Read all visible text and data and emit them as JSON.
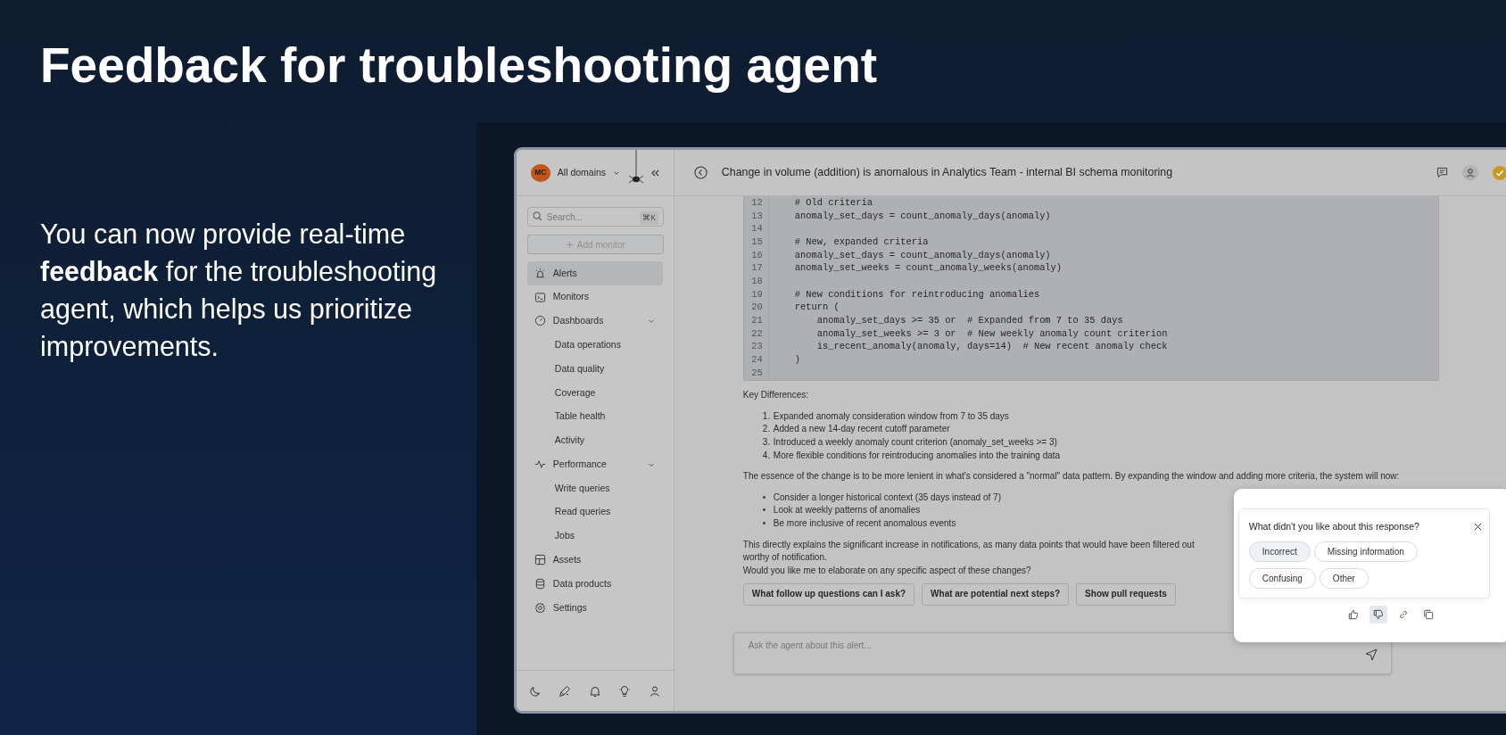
{
  "headline": "Feedback for troubleshooting agent",
  "blurb": "You can now provide real-time **feedback** for the troubleshooting agent, which helps us prioritize improvements.",
  "app": {
    "sidebar": {
      "avatar": "MC",
      "domain": "All domains",
      "search": {
        "placeholder": "Search...",
        "shortcut": "⌘K"
      },
      "add_button": {
        "label": "Add monitor",
        "disabled": true
      },
      "items": [
        {
          "label": "Alerts",
          "selected": true
        },
        {
          "label": "Monitors",
          "selected": false
        },
        {
          "label": "Dashboards",
          "selected": false,
          "expanded": true,
          "children": [
            {
              "label": "Data operations",
              "selected": false
            },
            {
              "label": "Data quality",
              "selected": false
            },
            {
              "label": "Coverage",
              "selected": false
            },
            {
              "label": "Table health",
              "selected": false
            },
            {
              "label": "Activity",
              "selected": false
            }
          ]
        },
        {
          "label": "Performance",
          "selected": false,
          "expanded": true,
          "children": [
            {
              "label": "Write queries",
              "selected": false
            },
            {
              "label": "Read queries",
              "selected": false
            },
            {
              "label": "Jobs",
              "selected": false
            }
          ]
        },
        {
          "label": "Assets",
          "selected": false
        },
        {
          "label": "Data products",
          "selected": false
        },
        {
          "label": "Settings",
          "selected": false
        }
      ]
    },
    "header": {
      "title": "Change in volume (addition) is anomalous in Analytics Team - internal BI schema monitoring"
    },
    "code": [
      {
        "n": "12",
        "text": "    # Old criteria"
      },
      {
        "n": "13",
        "text": "    anomaly_set_days = count_anomaly_days(anomaly)"
      },
      {
        "n": "14"
      },
      {
        "n": "15",
        "text": "    # New, expanded criteria"
      },
      {
        "n": "16",
        "text": "    anomaly_set_days = count_anomaly_days(anomaly)"
      },
      {
        "n": "17",
        "text": "    anomaly_set_weeks = count_anomaly_weeks(anomaly)"
      },
      {
        "n": "18"
      },
      {
        "n": "19",
        "text": "    # New conditions for reintroducing anomalies"
      },
      {
        "n": "20",
        "text": "    return ("
      },
      {
        "n": "21",
        "text": "        anomaly_set_days >= 35 or  # Expanded from 7 to 35 days"
      },
      {
        "n": "22",
        "text": "        anomaly_set_weeks >= 3 or  # New weekly anomaly count criterion"
      },
      {
        "n": "23",
        "text": "        is_recent_anomaly(anomaly, days=14)  # New recent anomaly check"
      },
      {
        "n": "24",
        "text": "    )"
      },
      {
        "n": "25"
      }
    ],
    "key_heading": "Key Differences:",
    "numbered": [
      {
        "marker": "1.",
        "text": "Expanded anomaly consideration window from 7 to 35 days"
      },
      {
        "marker": "2.",
        "text": "Added a new 14-day recent cutoff parameter"
      },
      {
        "marker": "3.",
        "text": "Introduced a weekly anomaly count criterion (anomaly_set_weeks >= 3)"
      },
      {
        "marker": "4.",
        "text": "More flexible conditions for reintroducing anomalies into the training data"
      }
    ],
    "paragraph": "The essence of the change is to be more lenient in what's considered a \"normal\" data pattern. By expanding the window and adding more criteria, the system will now:",
    "bullets": [
      {
        "marker": "•",
        "text": "Consider a longer historical context (35 days instead of 7)"
      },
      {
        "marker": "•",
        "text": "Look at weekly patterns of anomalies"
      },
      {
        "marker": "•",
        "text": "Be more inclusive of recent anomalous events"
      }
    ],
    "closing_lines": [
      "This directly explains the significant increase in notifications, as many data points that would have been filtered out",
      "worthy of notification.",
      "Would you like me to elaborate on any specific aspect of these changes?"
    ],
    "suggestions": [
      "What follow up questions can I ask?",
      "What are potential next steps?",
      "Show pull requests"
    ],
    "input": {
      "placeholder": "Ask the agent about this alert..."
    },
    "feedback": {
      "question": "What didn't you like about this response?",
      "options": [
        {
          "label": "Incorrect",
          "selected": true
        },
        {
          "label": "Missing information",
          "selected": false
        },
        {
          "label": "Confusing",
          "selected": false
        },
        {
          "label": "Other",
          "selected": false
        }
      ],
      "reactions": [
        {
          "kind": "thumbs_up",
          "selected": false
        },
        {
          "kind": "thumbs_down",
          "selected": true
        },
        {
          "kind": "link",
          "selected": false
        },
        {
          "kind": "copy",
          "selected": false
        }
      ]
    }
  }
}
